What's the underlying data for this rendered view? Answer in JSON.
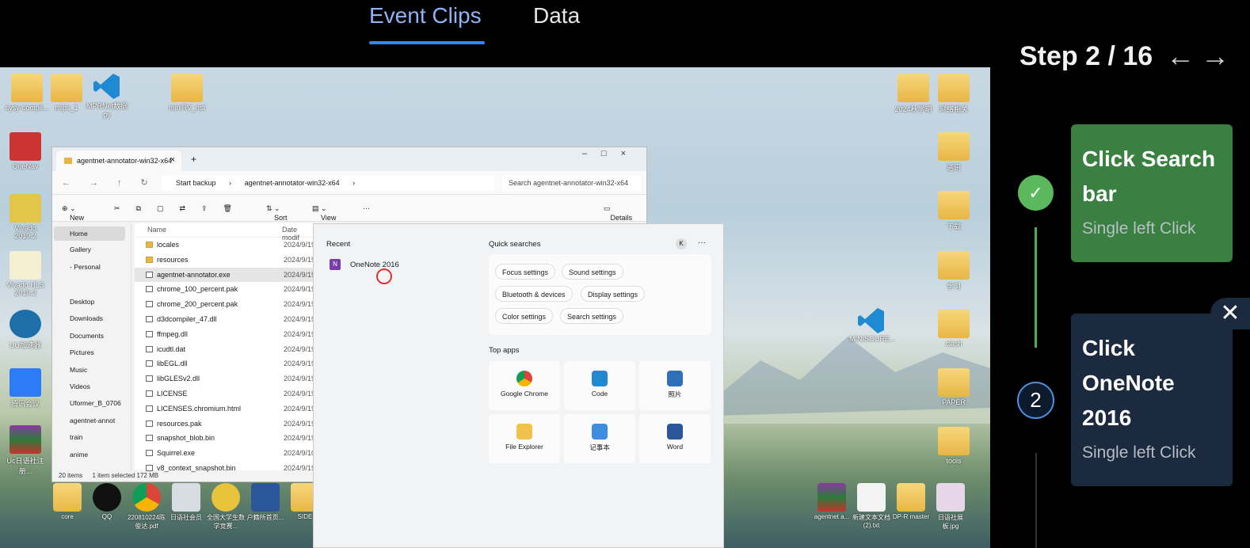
{
  "tabs": [
    {
      "label": "Event Clips",
      "active": true
    },
    {
      "label": "Data",
      "active": false
    }
  ],
  "screenshot": {
    "desktop_icons_left": [
      {
        "label": "sysy-compil..."
      },
      {
        "label": "mips_1"
      },
      {
        "label": "MPRNet数据py"
      },
      {
        "label": "miniRV_nst"
      },
      {
        "label": "OneNav"
      },
      {
        "label": "Vivado 2019.2"
      },
      {
        "label": "Vivado HLS 2019.2"
      },
      {
        "label": "UU加速器"
      },
      {
        "label": "腾讯会议"
      },
      {
        "label": "Uc日语社注册..."
      }
    ],
    "desktop_icons_right": [
      {
        "label": "2024秋学期"
      },
      {
        "label": "网络相关"
      },
      {
        "label": "通讯"
      },
      {
        "label": "下载"
      },
      {
        "label": "学习"
      },
      {
        "label": "clash"
      },
      {
        "label": "PAPER"
      },
      {
        "label": "tools"
      },
      {
        "label": "MINISOURE..."
      }
    ],
    "bottom_icons": [
      {
        "label": "core"
      },
      {
        "label": "QQ"
      },
      {
        "label": "220810224陈俊达.pdf"
      },
      {
        "label": "日语社会员"
      },
      {
        "label": "全国大学生数学竞赛..."
      },
      {
        "label": "户籍所首页..."
      },
      {
        "label": "SIDE"
      },
      {
        "label": "agentnet a..."
      },
      {
        "label": "新建文本文档 (2).txt"
      },
      {
        "label": "DP-R master"
      },
      {
        "label": "日语社展板.jpg"
      }
    ],
    "explorer": {
      "tab_title": "agentnet-annotator-win32-x64",
      "breadcrumb_start": "Start backup",
      "breadcrumb_folder": "agentnet-annotator-win32-x64",
      "search_placeholder": "Search agentnet-annotator-win32-x64",
      "commands": {
        "new": "New",
        "sort": "Sort",
        "view": "View",
        "details": "Details"
      },
      "nav_items": [
        "Home",
        "Gallery",
        "- Personal",
        "Desktop",
        "Downloads",
        "Documents",
        "Pictures",
        "Music",
        "Videos",
        "Uformer_B_0706",
        "agentnet-annot",
        "train",
        "anime"
      ],
      "col_name": "Name",
      "col_date": "Date modif",
      "files": [
        {
          "name": "locales",
          "date": "2024/9/19",
          "dir": true
        },
        {
          "name": "resources",
          "date": "2024/9/19",
          "dir": true
        },
        {
          "name": "agentnet-annotator.exe",
          "date": "2024/9/19",
          "dir": false,
          "selected": true
        },
        {
          "name": "chrome_100_percent.pak",
          "date": "2024/9/19",
          "dir": false
        },
        {
          "name": "chrome_200_percent.pak",
          "date": "2024/9/19",
          "dir": false
        },
        {
          "name": "d3dcompiler_47.dll",
          "date": "2024/9/19",
          "dir": false
        },
        {
          "name": "ffmpeg.dll",
          "date": "2024/9/19",
          "dir": false
        },
        {
          "name": "icudtl.dat",
          "date": "2024/9/19",
          "dir": false
        },
        {
          "name": "libEGL.dll",
          "date": "2024/9/19",
          "dir": false
        },
        {
          "name": "libGLESv2.dll",
          "date": "2024/9/19",
          "dir": false
        },
        {
          "name": "LICENSE",
          "date": "2024/9/19",
          "dir": false
        },
        {
          "name": "LICENSES.chromium.html",
          "date": "2024/9/19",
          "dir": false
        },
        {
          "name": "resources.pak",
          "date": "2024/9/19",
          "dir": false
        },
        {
          "name": "snapshot_blob.bin",
          "date": "2024/9/19",
          "dir": false
        },
        {
          "name": "Squirrel.exe",
          "date": "2024/9/10",
          "dir": false
        },
        {
          "name": "v8_context_snapshot.bin",
          "date": "2024/9/19",
          "dir": false
        }
      ],
      "status_count": "20 items",
      "status_selected": "1 item selected  172 MB"
    },
    "start_menu": {
      "recent_label": "Recent",
      "recent_item": "OneNote 2016",
      "quick_label": "Quick searches",
      "user_initial": "K",
      "chips": [
        "Focus settings",
        "Sound settings",
        "Bluetooth & devices",
        "Display settings",
        "Color settings",
        "Search settings"
      ],
      "top_apps_label": "Top apps",
      "apps": [
        "Google Chrome",
        "Code",
        "照片",
        "File Explorer",
        "记事本",
        "Word"
      ]
    }
  },
  "panel": {
    "step_label": "Step 2 / 16",
    "prev_arrow": "←",
    "next_arrow": "→",
    "steps": [
      {
        "action": "Click Search bar",
        "detail": "Single left Click",
        "status": "done"
      },
      {
        "action": "Click OneNote 2016",
        "detail": "Single left Click",
        "status": "current",
        "number": "2"
      }
    ],
    "close_symbol": "✕",
    "check_symbol": "✓"
  }
}
